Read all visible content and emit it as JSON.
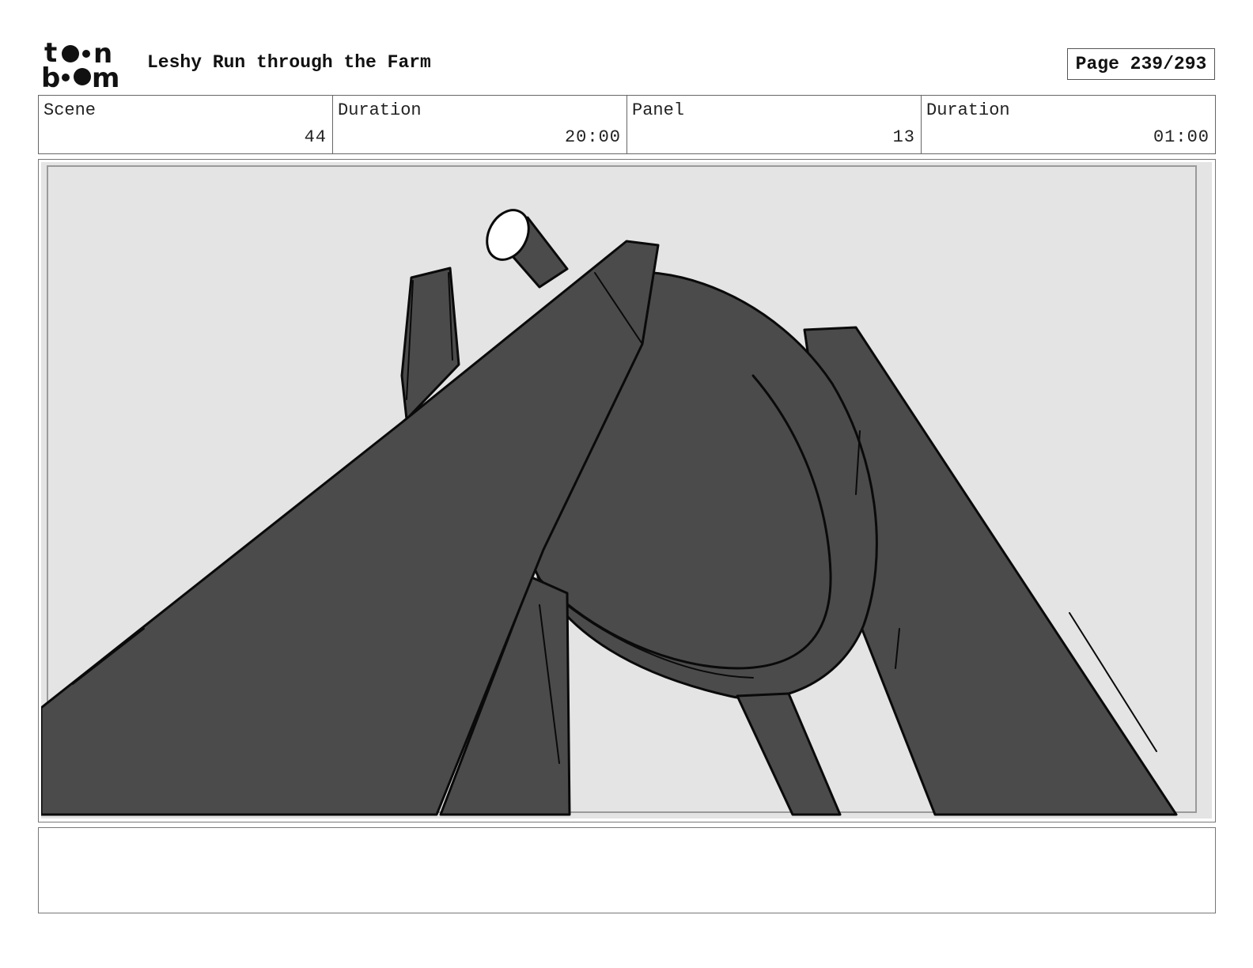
{
  "header": {
    "logo_text": "toon boom",
    "project_title": "Leshy Run through the Farm",
    "page_label": "Page 239/293"
  },
  "info": {
    "scene_label": "Scene",
    "scene_value": "44",
    "scene_duration_label": "Duration",
    "scene_duration_value": "20:00",
    "panel_label": "Panel",
    "panel_value": "13",
    "panel_duration_label": "Duration",
    "panel_duration_value": "01:00"
  },
  "panel": {
    "image_name": "storyboard-sketch",
    "colors": {
      "background": "#e4e4e4",
      "fill": "#4b4b4b",
      "stroke": "#0a0a0a"
    }
  },
  "notes": {
    "text": ""
  }
}
